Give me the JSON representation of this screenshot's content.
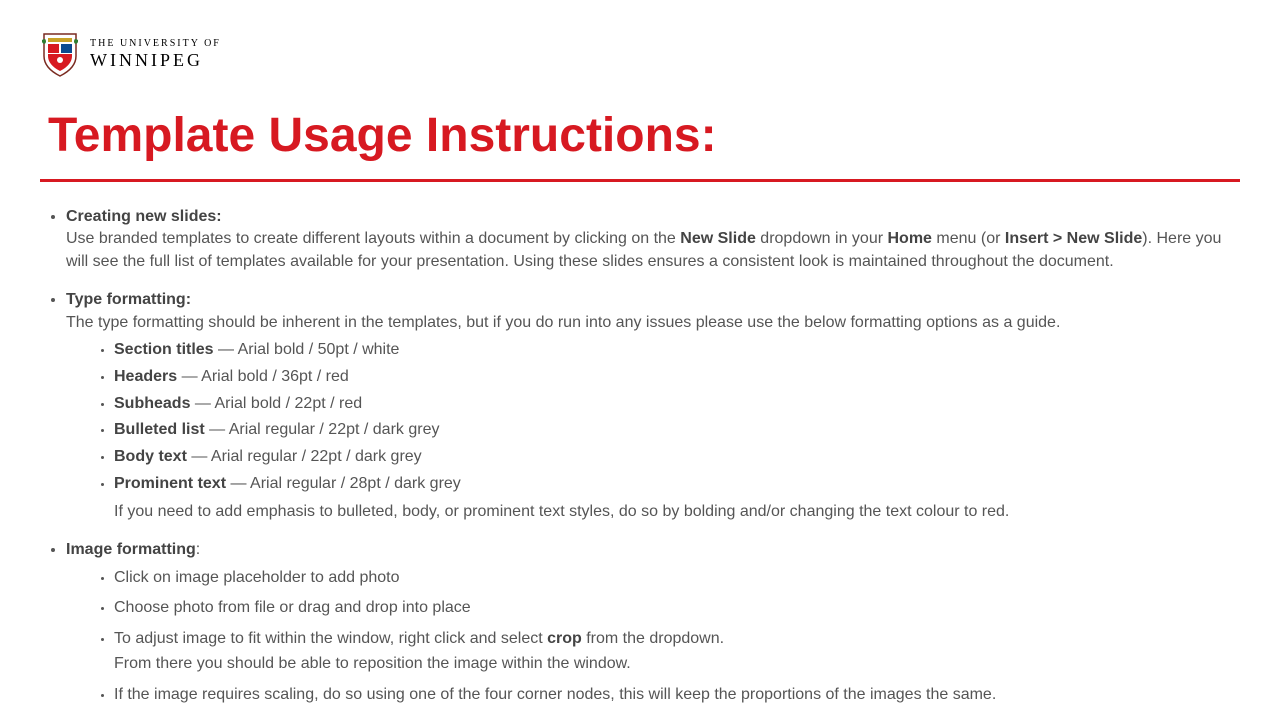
{
  "logo": {
    "line1": "THE UNIVERSITY OF",
    "line2": "WINNIPEG"
  },
  "title": "Template Usage Instructions:",
  "sections": {
    "creating": {
      "lead": "Creating new slides:",
      "p1a": "Use branded templates to create different layouts within a document by clicking on the ",
      "b1": "New Slide",
      "p1b": " dropdown in your ",
      "b2": "Home",
      "p1c": " menu (or ",
      "b3": "Insert > New Slide",
      "p1d": "). Here you will see the full list of templates available for your presentation. Using these slides ensures a consistent look is maintained throughout the document."
    },
    "typefmt": {
      "lead": "Type formatting:",
      "intro": "The type formatting should be inherent in the templates, but if you do run into any issues please use the below formatting options as a guide.",
      "items": [
        {
          "name": "Section titles",
          "spec": " — Arial bold / 50pt / white"
        },
        {
          "name": "Headers",
          "spec": " — Arial bold / 36pt / red"
        },
        {
          "name": "Subheads",
          "spec": " — Arial bold / 22pt / red"
        },
        {
          "name": "Bulleted list",
          "spec": " — Arial regular / 22pt / dark grey"
        },
        {
          "name": "Body text",
          "spec": " — Arial regular / 22pt / dark grey"
        },
        {
          "name": "Prominent text",
          "spec": " — Arial regular / 28pt / dark grey"
        }
      ],
      "note": "If you need to add emphasis to bulleted, body, or prominent text styles, do so by bolding and/or changing the text colour to red."
    },
    "imagefmt": {
      "lead": "Image formatting",
      "colon": ":",
      "i1": "Click on image placeholder to add photo",
      "i2": "Choose photo from file or drag and drop into place",
      "i3a": "To adjust image to fit within the window, right click and select ",
      "i3b": "crop",
      "i3c": " from the dropdown.",
      "i3d": "From there you should be able to reposition the image within the window.",
      "i4": "If the image requires scaling, do so using one of the four corner nodes, this will keep the proportions of the images the same."
    }
  }
}
